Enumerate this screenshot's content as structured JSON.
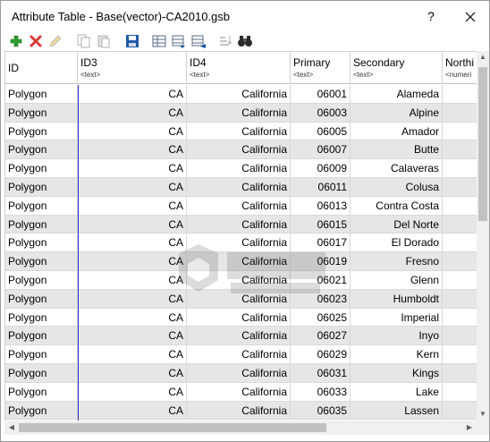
{
  "window": {
    "title": "Attribute Table - Base(vector)-CA2010.gsb",
    "help_label": "?",
    "close_icon": "close-icon"
  },
  "toolbar": {
    "icons": [
      "add-record-icon",
      "delete-record-icon",
      "edit-pencil-icon",
      "copy-icon",
      "paste-icon",
      "save-icon",
      "table-columns-icon",
      "table-import-icon",
      "table-export-icon",
      "sort-icon",
      "binoculars-icon"
    ]
  },
  "columns": [
    {
      "name": "ID",
      "type": ""
    },
    {
      "name": "ID3",
      "type": "<text>"
    },
    {
      "name": "ID4",
      "type": "<text>"
    },
    {
      "name": "Primary",
      "type": "<text>"
    },
    {
      "name": "Secondary",
      "type": "<text>"
    },
    {
      "name": "Northi",
      "type": "<numeri"
    }
  ],
  "rows": [
    {
      "id": "Polygon",
      "id3": "CA",
      "id4": "California",
      "primary": "06001",
      "secondary": "Alameda"
    },
    {
      "id": "Polygon",
      "id3": "CA",
      "id4": "California",
      "primary": "06003",
      "secondary": "Alpine"
    },
    {
      "id": "Polygon",
      "id3": "CA",
      "id4": "California",
      "primary": "06005",
      "secondary": "Amador"
    },
    {
      "id": "Polygon",
      "id3": "CA",
      "id4": "California",
      "primary": "06007",
      "secondary": "Butte"
    },
    {
      "id": "Polygon",
      "id3": "CA",
      "id4": "California",
      "primary": "06009",
      "secondary": "Calaveras"
    },
    {
      "id": "Polygon",
      "id3": "CA",
      "id4": "California",
      "primary": "06011",
      "secondary": "Colusa"
    },
    {
      "id": "Polygon",
      "id3": "CA",
      "id4": "California",
      "primary": "06013",
      "secondary": "Contra Costa"
    },
    {
      "id": "Polygon",
      "id3": "CA",
      "id4": "California",
      "primary": "06015",
      "secondary": "Del Norte"
    },
    {
      "id": "Polygon",
      "id3": "CA",
      "id4": "California",
      "primary": "06017",
      "secondary": "El Dorado"
    },
    {
      "id": "Polygon",
      "id3": "CA",
      "id4": "California",
      "primary": "06019",
      "secondary": "Fresno"
    },
    {
      "id": "Polygon",
      "id3": "CA",
      "id4": "California",
      "primary": "06021",
      "secondary": "Glenn"
    },
    {
      "id": "Polygon",
      "id3": "CA",
      "id4": "California",
      "primary": "06023",
      "secondary": "Humboldt"
    },
    {
      "id": "Polygon",
      "id3": "CA",
      "id4": "California",
      "primary": "06025",
      "secondary": "Imperial"
    },
    {
      "id": "Polygon",
      "id3": "CA",
      "id4": "California",
      "primary": "06027",
      "secondary": "Inyo"
    },
    {
      "id": "Polygon",
      "id3": "CA",
      "id4": "California",
      "primary": "06029",
      "secondary": "Kern"
    },
    {
      "id": "Polygon",
      "id3": "CA",
      "id4": "California",
      "primary": "06031",
      "secondary": "Kings"
    },
    {
      "id": "Polygon",
      "id3": "CA",
      "id4": "California",
      "primary": "06033",
      "secondary": "Lake"
    },
    {
      "id": "Polygon",
      "id3": "CA",
      "id4": "California",
      "primary": "06035",
      "secondary": "Lassen"
    }
  ],
  "colors": {
    "row_alt": "#e6e6e6",
    "add_green": "#2e9e2e",
    "delete_red": "#d83b3b",
    "save_blue": "#1e5aa8",
    "selection_line": "#2b2bcf"
  }
}
